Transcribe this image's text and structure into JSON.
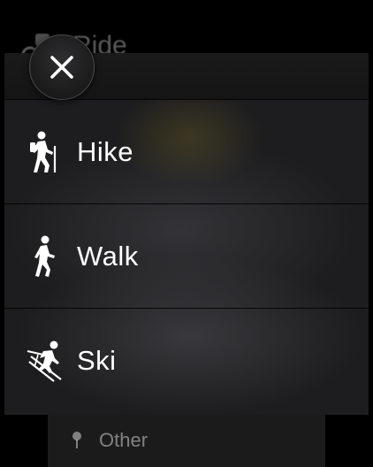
{
  "background": {
    "top_item_label": "Ride",
    "bottom_item_label": "Other"
  },
  "menu": {
    "items": [
      {
        "label": "Hike",
        "icon": "hiker-icon"
      },
      {
        "label": "Walk",
        "icon": "walker-icon"
      },
      {
        "label": "Ski",
        "icon": "skier-icon"
      }
    ]
  },
  "close_button": {
    "icon": "close-icon"
  },
  "colors": {
    "background": "#000000",
    "sheet": "#1d1d1f",
    "text": "#ffffff"
  }
}
